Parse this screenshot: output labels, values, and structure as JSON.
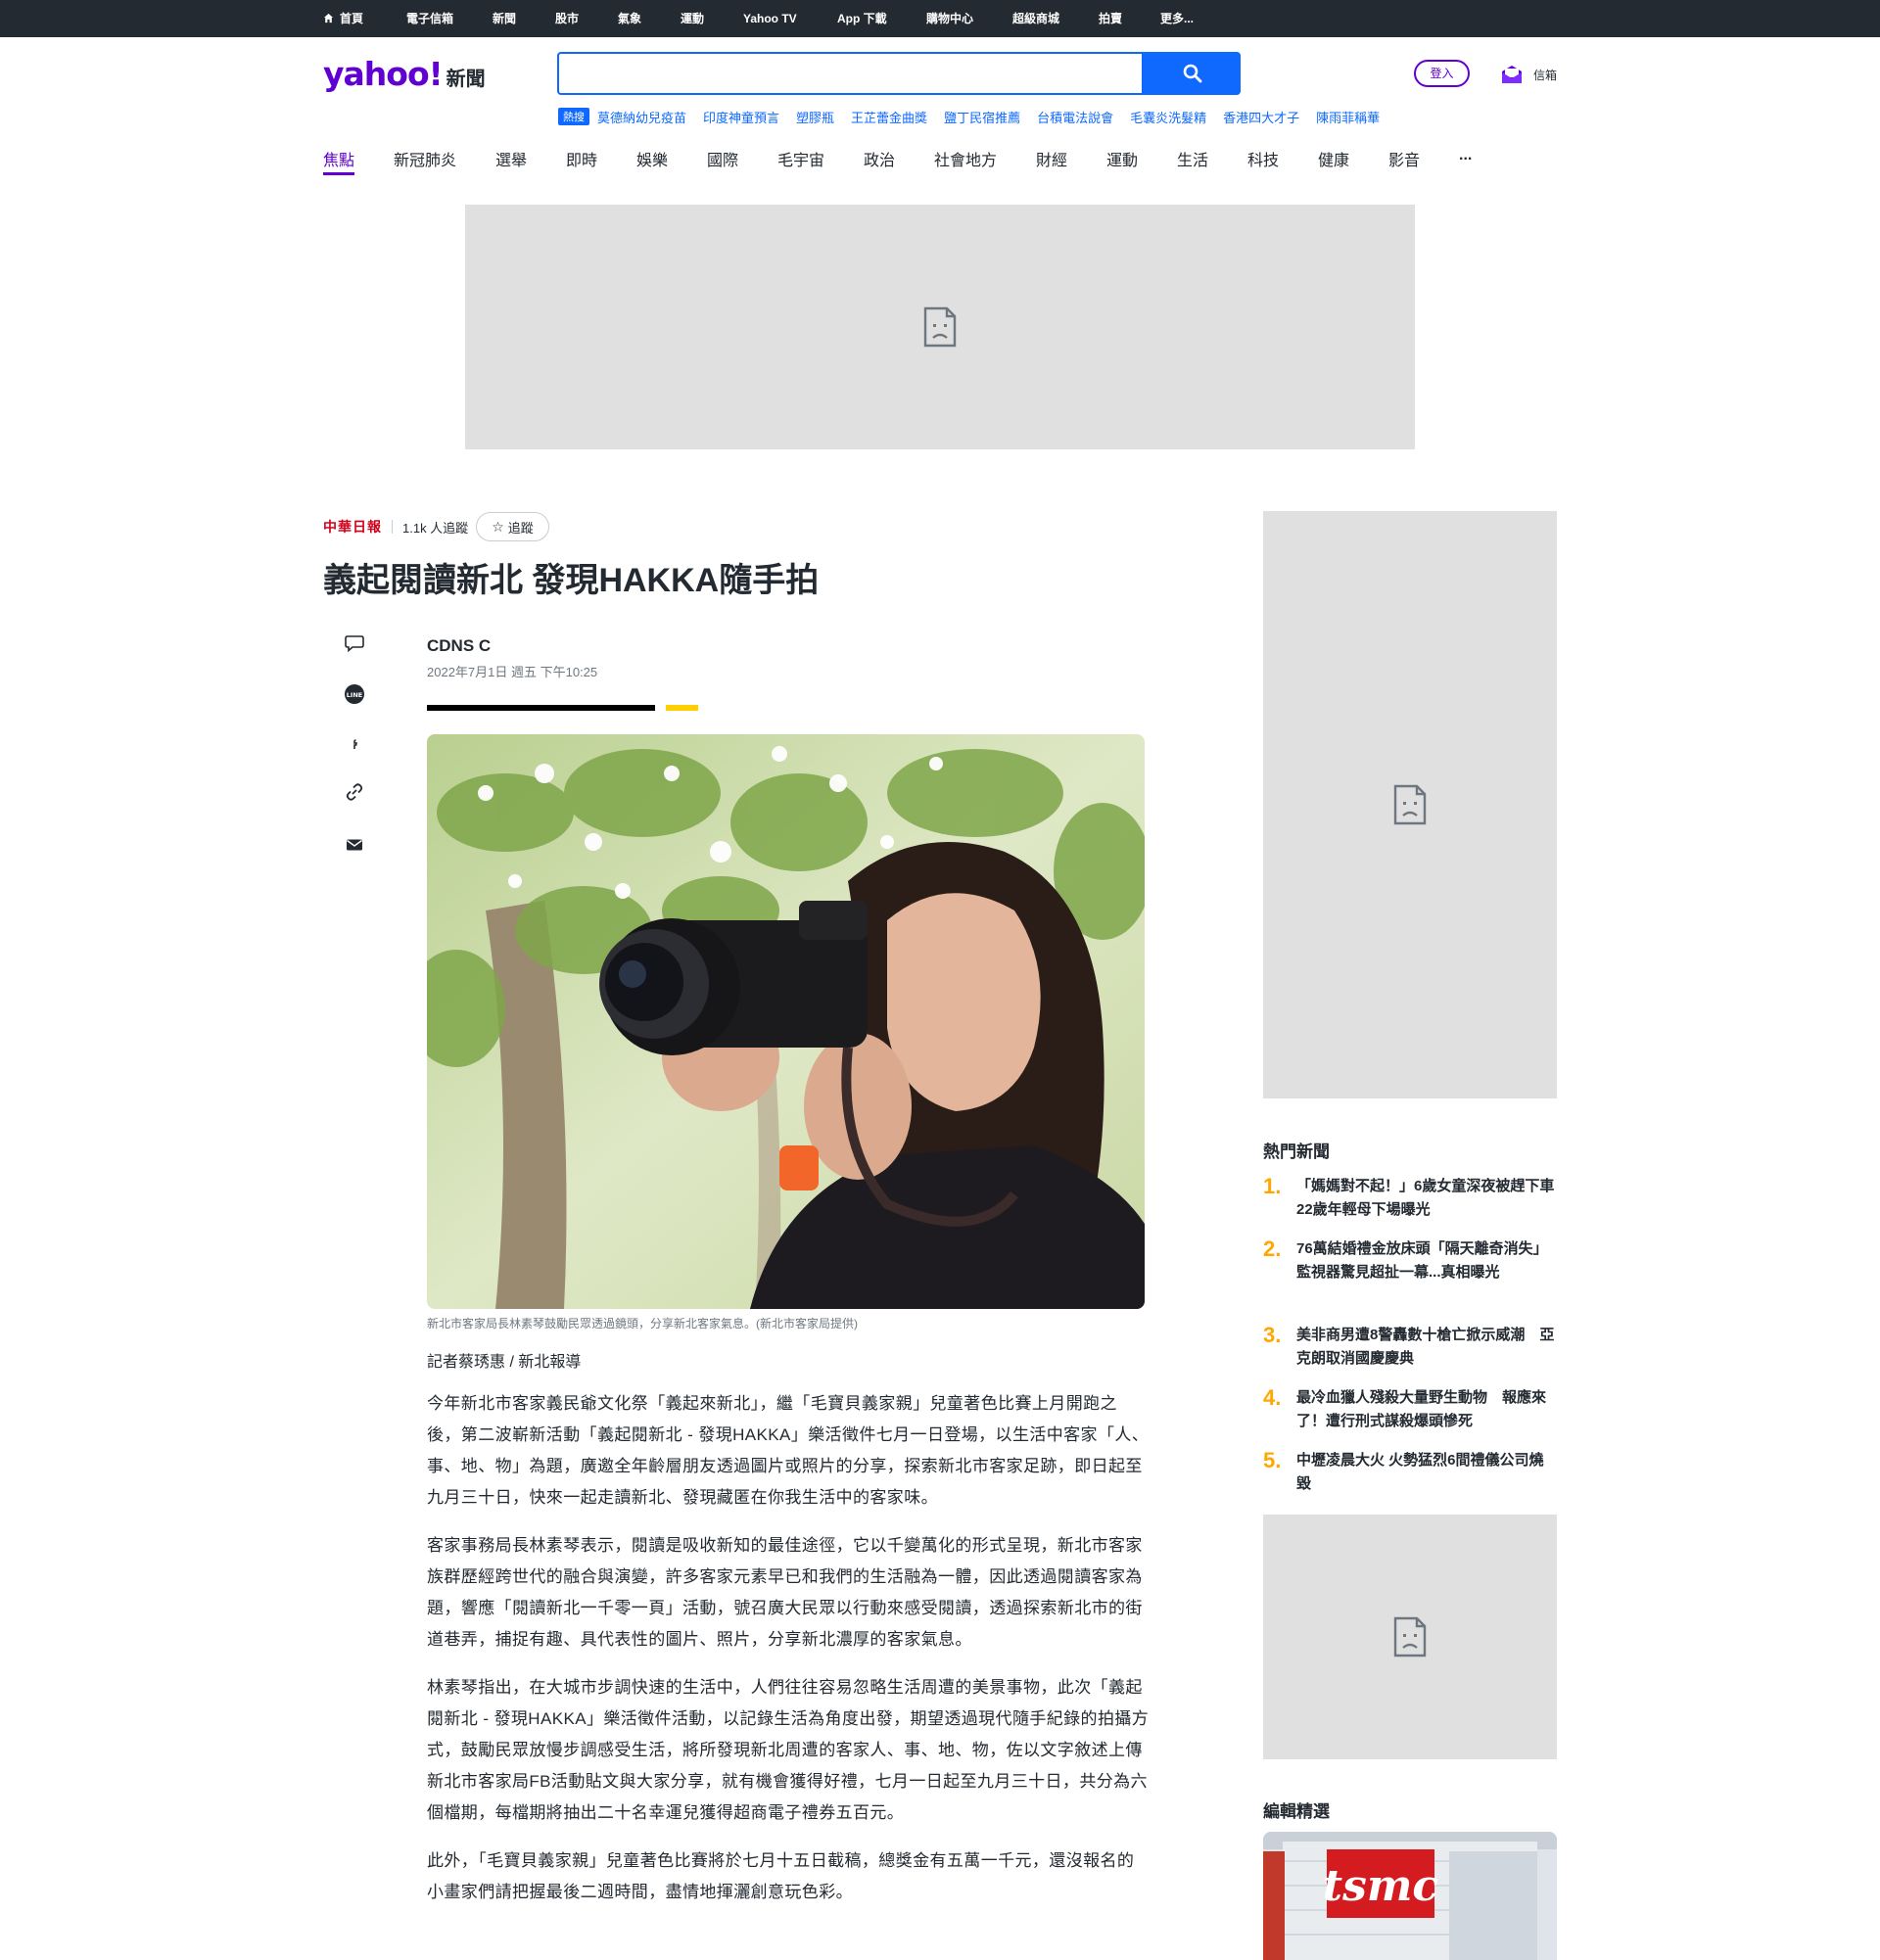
{
  "topbar": {
    "items": [
      "首頁",
      "電子信箱",
      "新聞",
      "股市",
      "氣象",
      "運動",
      "Yahoo TV",
      "App 下載",
      "購物中心",
      "超級商城",
      "拍賣",
      "更多..."
    ]
  },
  "header": {
    "logo_text": "yahoo!",
    "logo_sub": "新聞",
    "search_placeholder": "",
    "trending_label": "熱搜",
    "trending": [
      "莫德納幼兒疫苗",
      "印度神童預言",
      "塑膠瓶",
      "王芷蕾金曲獎",
      "鹽丁民宿推薦",
      "台積電法說會",
      "毛囊炎洗髮精",
      "香港四大才子",
      "陳雨菲稱華"
    ],
    "signin_label": "登入",
    "mail_label": "信箱"
  },
  "categories": [
    "焦點",
    "新冠肺炎",
    "選舉",
    "即時",
    "娛樂",
    "國際",
    "毛宇宙",
    "政治",
    "社會地方",
    "財經",
    "運動",
    "生活",
    "科技",
    "健康",
    "影音",
    "..."
  ],
  "article": {
    "publisher_logo": "中華日報",
    "followers": "1.1k 人追蹤",
    "follow_label": "追蹤",
    "title": "義起閱讀新北 發現HAKKA隨手拍",
    "author": "CDNS C",
    "date": "2022年7月1日 週五 下午10:25",
    "caption": "新北市客家局長林素琴鼓勵民眾透過鏡頭，分享新北客家氣息。(新北市客家局提供)",
    "byline": "記者蔡琇惠 / 新北報導",
    "paragraphs": [
      "今年新北市客家義民爺文化祭「義起來新北」，繼「毛寶貝義家親」兒童著色比賽上月開跑之後，第二波嶄新活動「義起閱新北 - 發現HAKKA」樂活徵件七月一日登場，以生活中客家「人、事、地、物」為題，廣邀全年齡層朋友透過圖片或照片的分享，探索新北市客家足跡，即日起至九月三十日，快來一起走讀新北、發現藏匿在你我生活中的客家味。",
      "客家事務局長林素琴表示，閱讀是吸收新知的最佳途徑，它以千變萬化的形式呈現，新北市客家族群歷經跨世代的融合與演變，許多客家元素早已和我們的生活融為一體，因此透過閱讀客家為題，響應「閱讀新北一千零一頁」活動，號召廣大民眾以行動來感受閱讀，透過探索新北市的街道巷弄，捕捉有趣、具代表性的圖片、照片，分享新北濃厚的客家氣息。",
      "林素琴指出，在大城市步調快速的生活中，人們往往容易忽略生活周遭的美景事物，此次「義起閱新北 - 發現HAKKA」樂活徵件活動，以記錄生活為角度出發，期望透過現代隨手紀錄的拍攝方式，鼓勵民眾放慢步調感受生活，將所發現新北周遭的客家人、事、地、物，佐以文字敘述上傳新北市客家局FB活動貼文與大家分享，就有機會獲得好禮，七月一日起至九月三十日，共分為六個檔期，每檔期將抽出二十名幸運兒獲得超商電子禮券五百元。",
      "此外，「毛寶貝義家親」兒童著色比賽將於七月十五日截稿，總獎金有五萬一千元，還沒報名的小畫家們請把握最後二週時間，盡情地揮灑創意玩色彩。"
    ]
  },
  "sidebar": {
    "hot_title": "熱門新聞",
    "hot_news": [
      {
        "num": "1.",
        "text": "「媽媽對不起！」6歲女童深夜被趕下車　22歲年輕母下場曝光"
      },
      {
        "num": "2.",
        "text": "76萬結婚禮金放床頭「隔天離奇消失」　監視器驚見超扯一幕...真相曝光"
      },
      {
        "num": "3.",
        "text": "美非商男遭8警轟數十槍亡掀示威潮　亞克朗取消國慶慶典"
      },
      {
        "num": "4.",
        "text": "最冷血獵人殘殺大量野生動物　報應來了！遭行刑式謀殺爆頭慘死"
      },
      {
        "num": "5.",
        "text": "中壢凌晨大火 火勢猛烈6間禮儀公司燒毀"
      }
    ],
    "editor_title": "編輯精選",
    "editor_image_text": "tsmc"
  },
  "colors": {
    "topbar_bg": "#232a31",
    "brand_purple": "#6001d2",
    "search_blue": "#0f69ff",
    "hot_number": "#ffa700",
    "ad_gray": "#e0e0e0"
  }
}
